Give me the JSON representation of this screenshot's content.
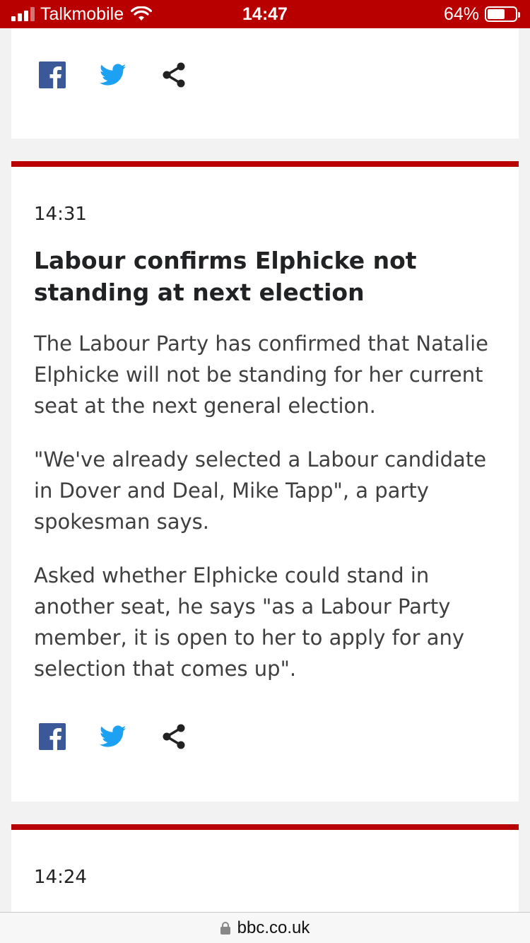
{
  "status_bar": {
    "carrier": "Talkmobile",
    "time": "14:47",
    "battery": "64%",
    "battery_level": 0.64,
    "icons": [
      "signal-icon",
      "wifi-icon",
      "battery-icon"
    ]
  },
  "top_card": {
    "share_icons": [
      "facebook-icon",
      "twitter-icon",
      "share-icon"
    ]
  },
  "post": {
    "time": "14:31",
    "headline": "Labour confirms Elphicke not standing at next election",
    "paragraphs": [
      "The Labour Party has confirmed that Natalie Elphicke will not be standing for her current seat at the next general election.",
      "\"We've already selected a Labour candidate in Dover and Deal, Mike Tapp\", a party spokesman says.",
      "Asked whether Elphicke could stand in another seat, he says \"as a Labour Party member, it is open to her to apply for any selection that comes up\"."
    ],
    "share_icons": [
      "facebook-icon",
      "twitter-icon",
      "share-icon"
    ]
  },
  "next_post": {
    "time": "14:24"
  },
  "url_bar": {
    "domain": "bbc.co.uk",
    "icon": "lock-icon"
  },
  "colors": {
    "accent": "#b80000",
    "facebook": "#3b5998",
    "twitter": "#1da1f2",
    "text": "#3f3f42",
    "background": "#f2f2f2"
  }
}
